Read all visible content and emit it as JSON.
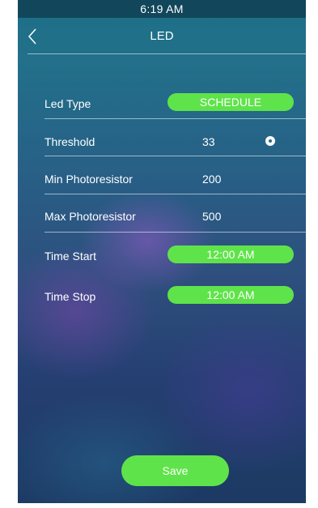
{
  "status_bar": {
    "time": "6:19 AM"
  },
  "header": {
    "title": "LED",
    "back_icon": "chevron-left-icon"
  },
  "settings": {
    "led_type": {
      "label": "Led Type",
      "value": "SCHEDULE"
    },
    "threshold": {
      "label": "Threshold",
      "value": "33"
    },
    "min_photoresistor": {
      "label": "Min Photoresistor",
      "value": "200"
    },
    "max_photoresistor": {
      "label": "Max Photoresistor",
      "value": "500"
    },
    "time_start": {
      "label": "Time Start",
      "value": "12:00 AM"
    },
    "time_stop": {
      "label": "Time Stop",
      "value": "12:00 AM"
    }
  },
  "save_button": {
    "label": "Save"
  },
  "colors": {
    "accent_green": "#5fe34a",
    "status_bar": "#12475b"
  }
}
